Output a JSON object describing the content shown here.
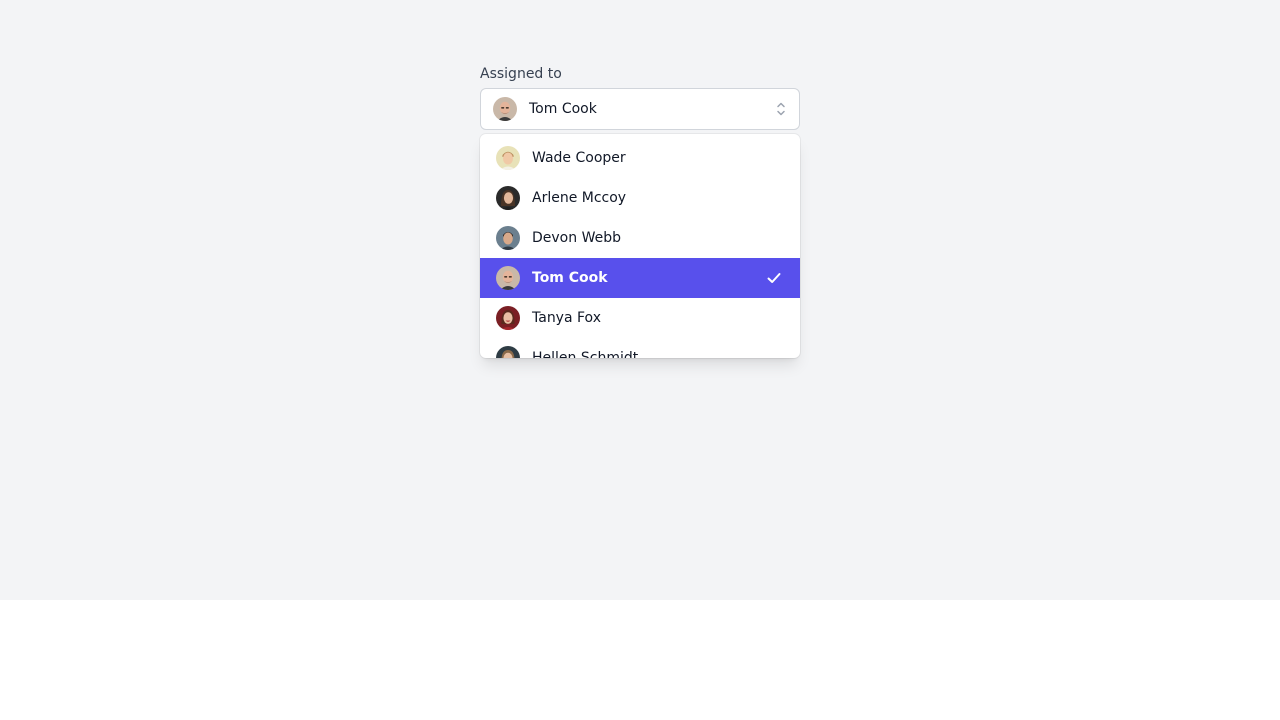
{
  "field": {
    "label": "Assigned to",
    "selected_value": "Tom Cook",
    "selected_avatar": "person-avatar-tom-cook",
    "chevron_icon": "chevron-up-down-icon"
  },
  "listbox": {
    "options": [
      {
        "label": "Wade Cooper",
        "avatar": "person-avatar-wade-cooper",
        "selected": false
      },
      {
        "label": "Arlene Mccoy",
        "avatar": "person-avatar-arlene-mccoy",
        "selected": false
      },
      {
        "label": "Devon Webb",
        "avatar": "person-avatar-devon-webb",
        "selected": false
      },
      {
        "label": "Tom Cook",
        "avatar": "person-avatar-tom-cook",
        "selected": true
      },
      {
        "label": "Tanya Fox",
        "avatar": "person-avatar-tanya-fox",
        "selected": false
      },
      {
        "label": "Hellen Schmidt",
        "avatar": "person-avatar-hellen-schmidt",
        "selected": false
      }
    ],
    "check_icon": "check-icon"
  },
  "colors": {
    "page_background": "#f3f4f6",
    "selected_option_background": "#5850ec",
    "selected_option_text": "#ffffff",
    "text": "#111827",
    "label_text": "#374151"
  }
}
